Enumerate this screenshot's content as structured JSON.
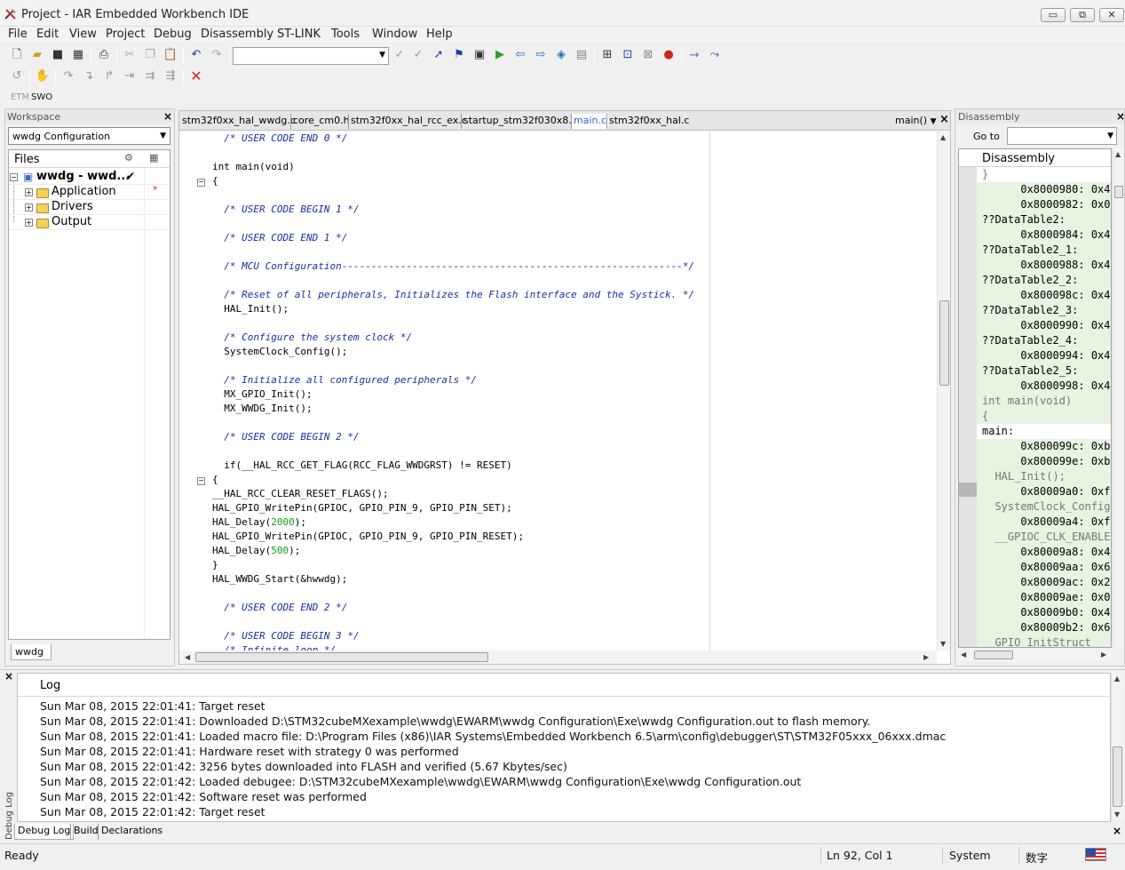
{
  "window": {
    "title": "Project - IAR Embedded Workbench IDE",
    "min": "▭",
    "restore": "⧉",
    "close": "✕"
  },
  "menu": [
    "File",
    "Edit",
    "View",
    "Project",
    "Debug",
    "Disassembly",
    "ST-LINK",
    "Tools",
    "Window",
    "Help"
  ],
  "toolbar3": {
    "etm": "ETM",
    "swo": "SWO"
  },
  "workspace": {
    "title": "Workspace",
    "config": "wwdg Configuration",
    "files_header": "Files",
    "project": "wwdg - wwd...",
    "check": "✔",
    "items": [
      "Application",
      "Drivers",
      "Output"
    ],
    "app_marker": "*",
    "tab": "wwdg"
  },
  "editor": {
    "tabs": [
      "stm32f0xx_hal_wwdg.c",
      "core_cm0.h",
      "stm32f0xx_hal_rcc_ex.c",
      "startup_stm32f030x8.s",
      "main.c",
      "stm32f0xx_hal.c"
    ],
    "active_tab": 4,
    "func_dropdown": "main()",
    "lines": [
      [
        "  ",
        "/* USER CODE END 0 */"
      ],
      [
        "",
        ""
      ],
      [
        "int main(void)",
        ""
      ],
      [
        "{",
        ""
      ],
      [
        "",
        ""
      ],
      [
        "  ",
        "/* USER CODE BEGIN 1 */"
      ],
      [
        "",
        ""
      ],
      [
        "  ",
        "/* USER CODE END 1 */"
      ],
      [
        "",
        ""
      ],
      [
        "  ",
        "/* MCU Configuration----------------------------------------------------------*/"
      ],
      [
        "",
        ""
      ],
      [
        "  ",
        "/* Reset of all peripherals, Initializes the Flash interface and the Systick. */"
      ],
      [
        "  HAL_Init();",
        ""
      ],
      [
        "",
        ""
      ],
      [
        "  ",
        "/* Configure the system clock */"
      ],
      [
        "  SystemClock_Config();",
        ""
      ],
      [
        "",
        ""
      ],
      [
        "  ",
        "/* Initialize all configured peripherals */"
      ],
      [
        "  MX_GPIO_Init();",
        ""
      ],
      [
        "  MX_WWDG_Init();",
        ""
      ],
      [
        "",
        ""
      ],
      [
        "  ",
        "/* USER CODE BEGIN 2 */"
      ],
      [
        "",
        ""
      ],
      [
        "  if(__HAL_RCC_GET_FLAG(RCC_FLAG_WWDGRST) != RESET)",
        ""
      ],
      [
        "{",
        ""
      ],
      [
        "__HAL_RCC_CLEAR_RESET_FLAGS();",
        ""
      ],
      [
        "HAL_GPIO_WritePin(GPIOC, GPIO_PIN_9, GPIO_PIN_SET);",
        ""
      ],
      [
        "HAL_Delay(",
        "",
        "2000",
        ");"
      ],
      [
        "HAL_GPIO_WritePin(GPIOC, GPIO_PIN_9, GPIO_PIN_RESET);",
        ""
      ],
      [
        "HAL_Delay(",
        "",
        "500",
        ");"
      ],
      [
        "}",
        ""
      ],
      [
        "HAL_WWDG_Start(&hwwdg);",
        ""
      ],
      [
        "",
        ""
      ],
      [
        "  ",
        "/* USER CODE END 2 */"
      ],
      [
        "",
        ""
      ],
      [
        "  ",
        "/* USER CODE BEGIN 3 */"
      ],
      [
        "  ",
        "/* Infinite loop */"
      ]
    ]
  },
  "disasm": {
    "title": "Disassembly",
    "goto": "Go to",
    "header": "Disassembly",
    "lines": [
      [
        "}",
        "gray"
      ],
      [
        "      0x8000980: 0x4",
        "green"
      ],
      [
        "      0x8000982: 0x0",
        "green"
      ],
      [
        "??DataTable2:",
        "green"
      ],
      [
        "      0x8000984: 0x4",
        "green"
      ],
      [
        "??DataTable2_1:",
        "green"
      ],
      [
        "      0x8000988: 0x4",
        "green"
      ],
      [
        "??DataTable2_2:",
        "green"
      ],
      [
        "      0x800098c: 0x4",
        "green"
      ],
      [
        "??DataTable2_3:",
        "green"
      ],
      [
        "      0x8000990: 0x4",
        "green"
      ],
      [
        "??DataTable2_4:",
        "green"
      ],
      [
        "      0x8000994: 0x4",
        "green"
      ],
      [
        "??DataTable2_5:",
        "green"
      ],
      [
        "      0x8000998: 0x4",
        "green"
      ],
      [
        "int main(void)",
        "graygreen"
      ],
      [
        "{",
        "graygreen"
      ],
      [
        "main:",
        "white"
      ],
      [
        "      0x800099c: 0xb",
        "green"
      ],
      [
        "      0x800099e: 0xb",
        "green"
      ],
      [
        "  HAL_Init();",
        "graygreen"
      ],
      [
        "      0x80009a0: 0xf",
        "green"
      ],
      [
        "  SystemClock_Config",
        "graygreen"
      ],
      [
        "      0x80009a4: 0xf",
        "green"
      ],
      [
        "  __GPIOC_CLK_ENABLE",
        "graygreen"
      ],
      [
        "      0x80009a8: 0x4",
        "green"
      ],
      [
        "      0x80009aa: 0x6",
        "green"
      ],
      [
        "      0x80009ac: 0x2",
        "green"
      ],
      [
        "      0x80009ae: 0x0",
        "green"
      ],
      [
        "      0x80009b0: 0x4",
        "green"
      ],
      [
        "      0x80009b2: 0x6",
        "green"
      ],
      [
        "  GPIO_InitStruct",
        "graygreen"
      ]
    ]
  },
  "log": {
    "header": "Log",
    "side_label": "Debug Log",
    "lines": [
      "Sun Mar 08, 2015 22:01:41: Target reset",
      "Sun Mar 08, 2015 22:01:41: Downloaded D:\\STM32cubeMXexample\\wwdg\\EWARM\\wwdg Configuration\\Exe\\wwdg Configuration.out to flash memory.",
      "Sun Mar 08, 2015 22:01:41: Loaded macro file: D:\\Program Files (x86)\\IAR Systems\\Embedded Workbench 6.5\\arm\\config\\debugger\\ST\\STM32F05xxx_06xxx.dmac",
      "Sun Mar 08, 2015 22:01:41: Hardware reset with strategy 0 was performed",
      "Sun Mar 08, 2015 22:01:42: 3256 bytes downloaded into FLASH and verified (5.67 Kbytes/sec)",
      "Sun Mar 08, 2015 22:01:42: Loaded debugee: D:\\STM32cubeMXexample\\wwdg\\EWARM\\wwdg Configuration\\Exe\\wwdg Configuration.out",
      "Sun Mar 08, 2015 22:01:42: Software reset was performed",
      "Sun Mar 08, 2015 22:01:42: Target reset"
    ],
    "tabs": [
      "Debug Log",
      "Build",
      "Declarations"
    ]
  },
  "status": {
    "ready": "Ready",
    "position": "Ln 92, Col 1",
    "mode": "System",
    "ime": "数字"
  },
  "colors": {
    "comment": "#1a2ea8",
    "number": "#16a016",
    "active_tab": "#2a6ad8",
    "disasm_green": "#e6f4e1",
    "stop": "#e02020"
  }
}
